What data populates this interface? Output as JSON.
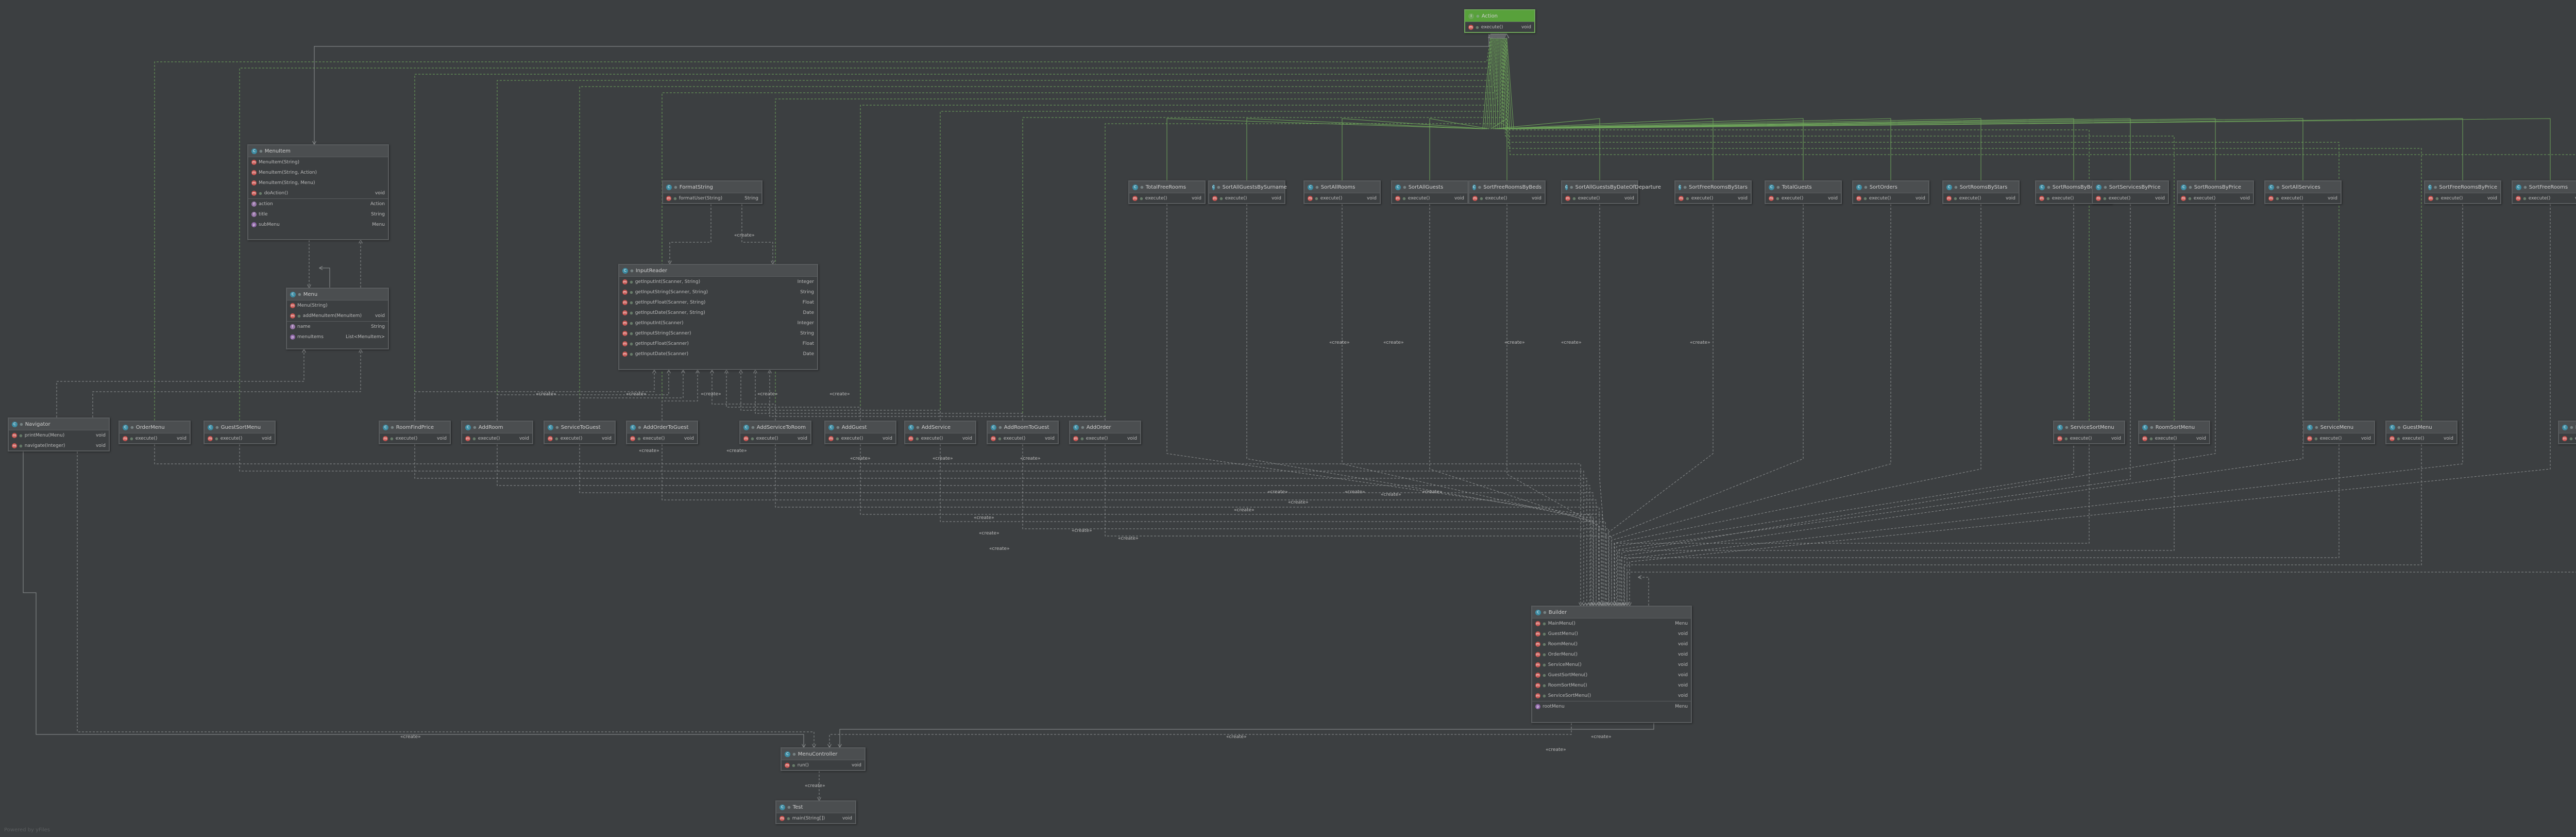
{
  "watermark": "Powered by yFiles",
  "colors": {
    "background": "#3c3f41",
    "node_border": "#595c5e",
    "edge": "#8d9091",
    "highlight": "#6ea55a",
    "method_icon": "#c75450",
    "field_icon": "#9876aa",
    "class_icon": "#3d8ca3"
  },
  "edge_label": "«create»",
  "classes": {
    "action": {
      "name": "Action",
      "kind": "interface",
      "members": [
        {
          "name": "execute()",
          "type": "void"
        }
      ]
    },
    "menuitem": {
      "name": "MenuItem",
      "members": [
        {
          "name": "MenuItem(String)",
          "type": ""
        },
        {
          "name": "MenuItem(String, Action)",
          "type": ""
        },
        {
          "name": "MenuItem(String, Menu)",
          "type": ""
        },
        {
          "name": "doAction()",
          "type": "void"
        },
        {
          "name": "action",
          "type": "Action",
          "kind": "field"
        },
        {
          "name": "title",
          "type": "String",
          "kind": "field"
        },
        {
          "name": "subMenu",
          "type": "Menu",
          "kind": "field"
        }
      ]
    },
    "menu": {
      "name": "Menu",
      "members": [
        {
          "name": "Menu(String)",
          "type": ""
        },
        {
          "name": "addMenuItem(MenuItem)",
          "type": "void"
        },
        {
          "name": "name",
          "type": "String",
          "kind": "field"
        },
        {
          "name": "menuItems",
          "type": "List<MenuItem>",
          "kind": "field"
        }
      ]
    },
    "formatstring": {
      "name": "FormatString",
      "members": [
        {
          "name": "formatUser(String)",
          "type": "String"
        }
      ]
    },
    "inputreader": {
      "name": "InputReader",
      "members": [
        {
          "name": "getInputInt(Scanner, String)",
          "type": "Integer"
        },
        {
          "name": "getInputString(Scanner, String)",
          "type": "String"
        },
        {
          "name": "getInputFloat(Scanner, String)",
          "type": "Float"
        },
        {
          "name": "getInputDate(Scanner, String)",
          "type": "Date"
        },
        {
          "name": "getInputInt(Scanner)",
          "type": "Integer"
        },
        {
          "name": "getInputString(Scanner)",
          "type": "String"
        },
        {
          "name": "getInputFloat(Scanner)",
          "type": "Float"
        },
        {
          "name": "getInputDate(Scanner)",
          "type": "Date"
        }
      ]
    },
    "navigator": {
      "name": "Navigator",
      "members": [
        {
          "name": "printMenu(Menu)",
          "type": "void"
        },
        {
          "name": "navigate(Integer)",
          "type": "void"
        }
      ]
    },
    "builder": {
      "name": "Builder",
      "members": [
        {
          "name": "MainMenu()",
          "type": "Menu"
        },
        {
          "name": "GuestMenu()",
          "type": "void"
        },
        {
          "name": "RoomMenu()",
          "type": "void"
        },
        {
          "name": "OrderMenu()",
          "type": "void"
        },
        {
          "name": "ServiceMenu()",
          "type": "void"
        },
        {
          "name": "GuestSortMenu()",
          "type": "void"
        },
        {
          "name": "RoomSortMenu()",
          "type": "void"
        },
        {
          "name": "ServiceSortMenu()",
          "type": "void"
        },
        {
          "name": "rootMenu",
          "type": "Menu",
          "kind": "field"
        }
      ]
    },
    "menucontroller": {
      "name": "MenuController",
      "members": [
        {
          "name": "run()",
          "type": "void"
        }
      ]
    },
    "test": {
      "name": "Test",
      "members": [
        {
          "name": "main(String[])",
          "type": "void"
        }
      ]
    }
  },
  "top_actions": [
    {
      "name": "TotalFreeRooms"
    },
    {
      "name": "SortAllGuestsBySurname"
    },
    {
      "name": "SortAllRooms"
    },
    {
      "name": "SortAllGuests"
    },
    {
      "name": "SortFreeRoomsByBeds"
    },
    {
      "name": "SortAllGuestsByDateOfDeparture"
    },
    {
      "name": "SortFreeRoomsByStars"
    },
    {
      "name": "TotalGuests"
    },
    {
      "name": "SortOrders"
    },
    {
      "name": "SortRoomsByStars"
    },
    {
      "name": "SortRoomsByBeds"
    },
    {
      "name": "SortServicesByPrice"
    },
    {
      "name": "SortRoomsByPrice"
    },
    {
      "name": "SortAllServices"
    },
    {
      "name": "SortFreeRoomsByPrice"
    },
    {
      "name": "SortFreeRooms"
    }
  ],
  "mid_actions": [
    {
      "name": "OrderMenu"
    },
    {
      "name": "GuestSortMenu"
    },
    {
      "name": "RoomFindPrice"
    },
    {
      "name": "AddRoom"
    },
    {
      "name": "ServiceToGuest"
    },
    {
      "name": "AddOrderToGuest"
    },
    {
      "name": "AddServiceToRoom"
    },
    {
      "name": "AddGuest"
    },
    {
      "name": "AddService"
    },
    {
      "name": "AddRoomToGuest"
    },
    {
      "name": "AddOrder"
    },
    {
      "name": "ServiceSortMenu"
    },
    {
      "name": "RoomSortMenu"
    },
    {
      "name": "ServiceMenu"
    },
    {
      "name": "GuestMenu"
    },
    {
      "name": "RoomMenu"
    }
  ],
  "action_method": {
    "name": "execute()",
    "type": "void"
  }
}
